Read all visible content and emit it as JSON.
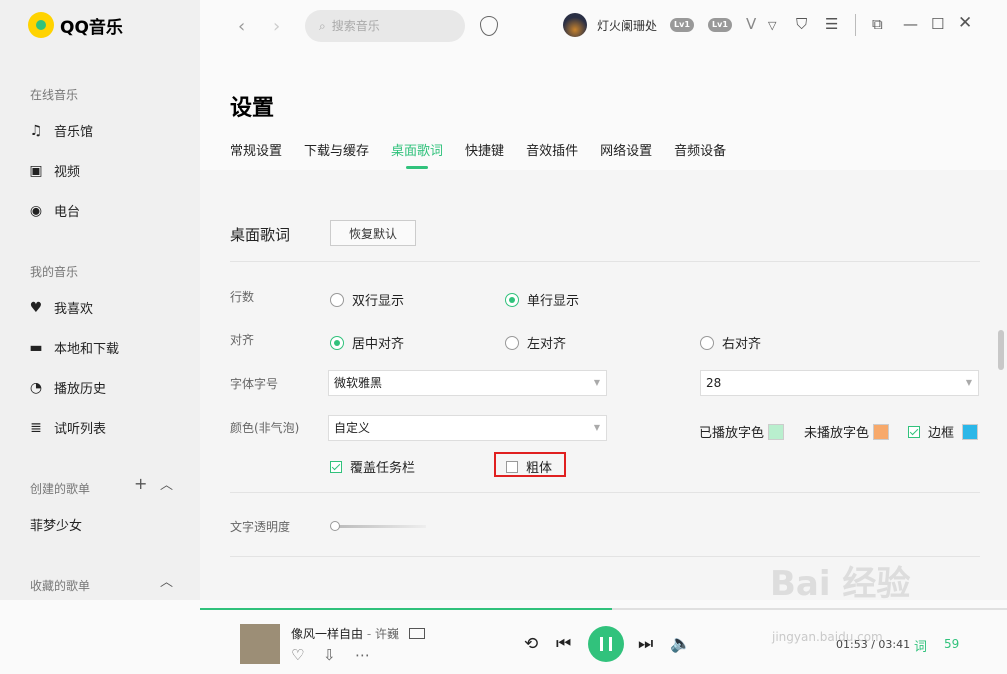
{
  "app": {
    "name": "QQ音乐"
  },
  "sidebar": {
    "sections": {
      "online": "在线音乐",
      "mine": "我的音乐",
      "created": "创建的歌单",
      "collected": "收藏的歌单"
    },
    "online_items": [
      {
        "label": "音乐馆",
        "icon": "music-note-icon"
      },
      {
        "label": "视频",
        "icon": "video-icon"
      },
      {
        "label": "电台",
        "icon": "radio-icon"
      }
    ],
    "mine_items": [
      {
        "label": "我喜欢",
        "icon": "heart-icon"
      },
      {
        "label": "本地和下载",
        "icon": "monitor-icon"
      },
      {
        "label": "播放历史",
        "icon": "clock-icon"
      },
      {
        "label": "试听列表",
        "icon": "playlist-icon"
      }
    ],
    "created_playlists": [
      "菲梦少女"
    ]
  },
  "topbar": {
    "search_placeholder": "搜索音乐",
    "username": "灯火阑珊处",
    "badges": [
      "Lv1",
      "Lv1"
    ]
  },
  "settings": {
    "title": "设置",
    "tabs": [
      "常规设置",
      "下载与缓存",
      "桌面歌词",
      "快捷键",
      "音效插件",
      "网络设置",
      "音频设备"
    ],
    "active_tab": "桌面歌词",
    "section_title": "桌面歌词",
    "reset_label": "恢复默认",
    "lines_label": "行数",
    "lines_options": [
      "双行显示",
      "单行显示"
    ],
    "lines_selected": "单行显示",
    "align_label": "对齐",
    "align_options": [
      "居中对齐",
      "左对齐",
      "右对齐"
    ],
    "align_selected": "居中对齐",
    "font_label": "字体字号",
    "font_family": "微软雅黑",
    "font_size": "28",
    "color_label": "颜色(非气泡)",
    "color_mode": "自定义",
    "played_color_label": "已播放字色",
    "played_color": "#b9efce",
    "unplayed_color_label": "未播放字色",
    "unplayed_color": "#f7a96b",
    "border_label": "边框",
    "border_checked": true,
    "border_color": "#2bb7e8",
    "cover_taskbar_label": "覆盖任务栏",
    "cover_taskbar_checked": true,
    "bold_label": "粗体",
    "bold_checked": false,
    "opacity_label": "文字透明度",
    "opacity_value": 0.0
  },
  "player": {
    "song": "像风一样自由",
    "separator": "-",
    "artist": "许巍",
    "time": "01:53 / 03:41",
    "lyric_label": "词",
    "playlist_count": "59",
    "progress": 0.51
  },
  "watermark": {
    "text": "Bai 经验",
    "sub": "jingyan.baidu.com"
  },
  "colors": {
    "accent": "#31c27c",
    "highlight": "#e02020"
  }
}
